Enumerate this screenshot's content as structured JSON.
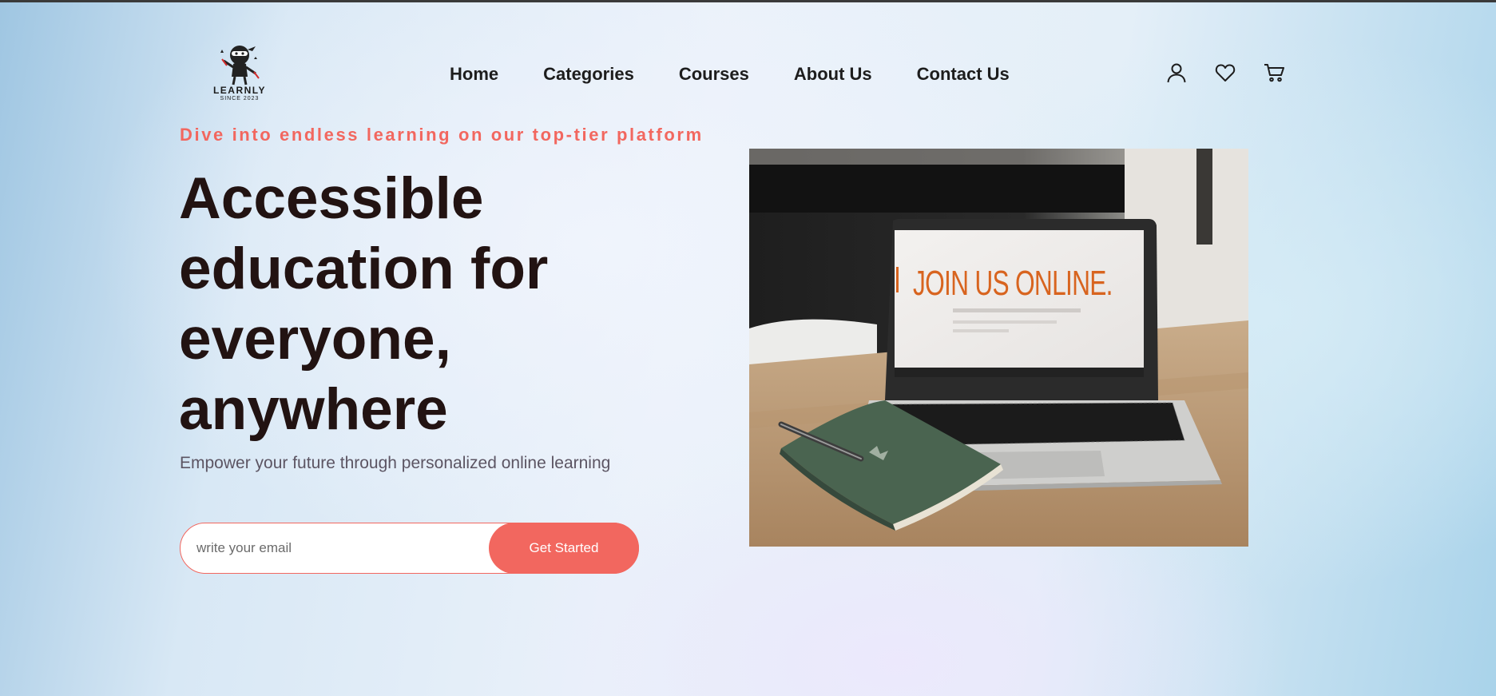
{
  "brand": {
    "name": "LEARNLY",
    "tagline": "SINCE 2023"
  },
  "nav": {
    "items": [
      {
        "label": "Home"
      },
      {
        "label": "Categories"
      },
      {
        "label": "Courses"
      },
      {
        "label": "About Us"
      },
      {
        "label": "Contact Us"
      }
    ]
  },
  "header_icons": [
    "user-icon",
    "heart-icon",
    "cart-icon"
  ],
  "hero": {
    "eyebrow": "Dive into endless learning on our top-tier platform",
    "headline": "Accessible education for everyone, anywhere",
    "subline": "Empower your future through personalized online learning",
    "email_placeholder": "write your email",
    "cta_label": "Get Started",
    "image_screen_text": "JOIN US ONLINE."
  },
  "colors": {
    "accent": "#f2675f",
    "headline": "#221312",
    "nav_text": "#1d1d1d"
  }
}
